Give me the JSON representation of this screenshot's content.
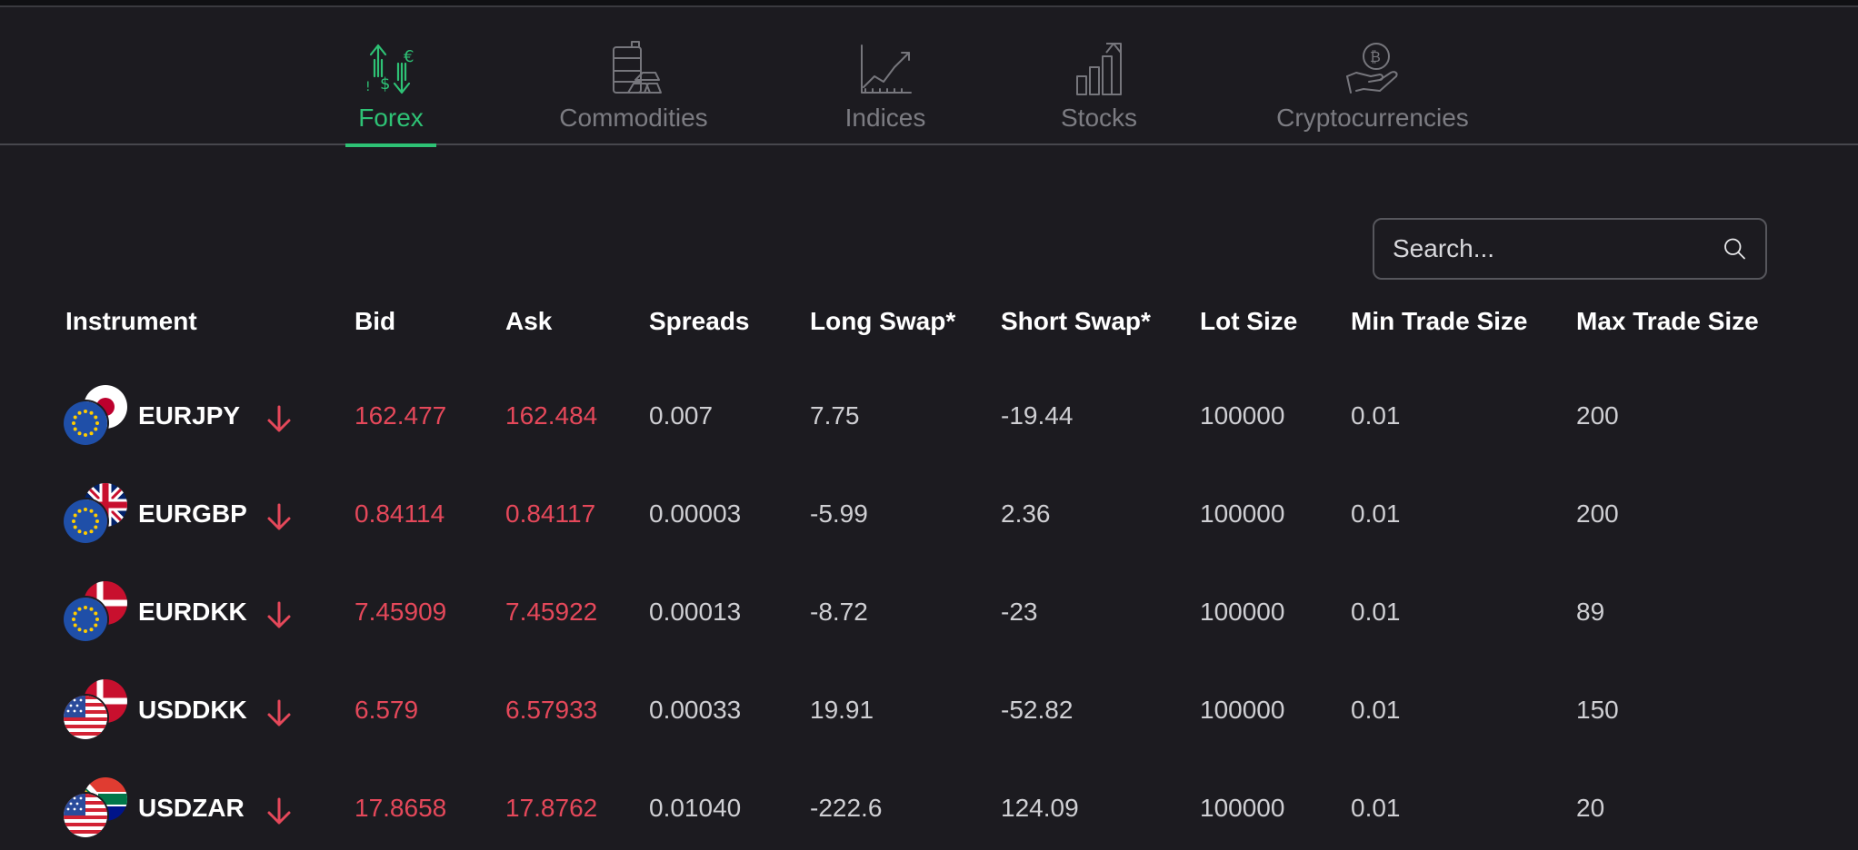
{
  "tabs": [
    {
      "label": "Forex",
      "icon": "currency-exchange-icon",
      "active": true
    },
    {
      "label": "Commodities",
      "icon": "oil-barrel-gold-icon",
      "active": false
    },
    {
      "label": "Indices",
      "icon": "line-chart-icon",
      "active": false
    },
    {
      "label": "Stocks",
      "icon": "bar-chart-growth-icon",
      "active": false
    },
    {
      "label": "Cryptocurrencies",
      "icon": "bitcoin-hand-icon",
      "active": false
    }
  ],
  "search": {
    "placeholder": "Search..."
  },
  "table": {
    "headers": {
      "instrument": "Instrument",
      "bid": "Bid",
      "ask": "Ask",
      "spreads": "Spreads",
      "long_swap": "Long Swap*",
      "short_swap": "Short Swap*",
      "lot_size": "Lot Size",
      "min_trade": "Min Trade Size",
      "max_trade": "Max Trade Size"
    },
    "rows": [
      {
        "symbol": "EURJPY",
        "bid": "162.477",
        "ask": "162.484",
        "spread": "0.007",
        "long_swap": "7.75",
        "short_swap": "-19.44",
        "lot_size": "100000",
        "min_trade": "0.01",
        "max_trade": "200",
        "trend": "down"
      },
      {
        "symbol": "EURGBP",
        "bid": "0.84114",
        "ask": "0.84117",
        "spread": "0.00003",
        "long_swap": "-5.99",
        "short_swap": "2.36",
        "lot_size": "100000",
        "min_trade": "0.01",
        "max_trade": "200",
        "trend": "down"
      },
      {
        "symbol": "EURDKK",
        "bid": "7.45909",
        "ask": "7.45922",
        "spread": "0.00013",
        "long_swap": "-8.72",
        "short_swap": "-23",
        "lot_size": "100000",
        "min_trade": "0.01",
        "max_trade": "89",
        "trend": "down"
      },
      {
        "symbol": "USDDKK",
        "bid": "6.579",
        "ask": "6.57933",
        "spread": "0.00033",
        "long_swap": "19.91",
        "short_swap": "-52.82",
        "lot_size": "100000",
        "min_trade": "0.01",
        "max_trade": "150",
        "trend": "down"
      },
      {
        "symbol": "USDZAR",
        "bid": "17.8658",
        "ask": "17.8762",
        "spread": "0.01040",
        "long_swap": "-222.6",
        "short_swap": "124.09",
        "lot_size": "100000",
        "min_trade": "0.01",
        "max_trade": "20",
        "trend": "down"
      }
    ]
  },
  "colors": {
    "accent": "#2ec275",
    "price_down": "#e5485a",
    "background": "#1c1b20",
    "muted": "#7c7c82"
  }
}
